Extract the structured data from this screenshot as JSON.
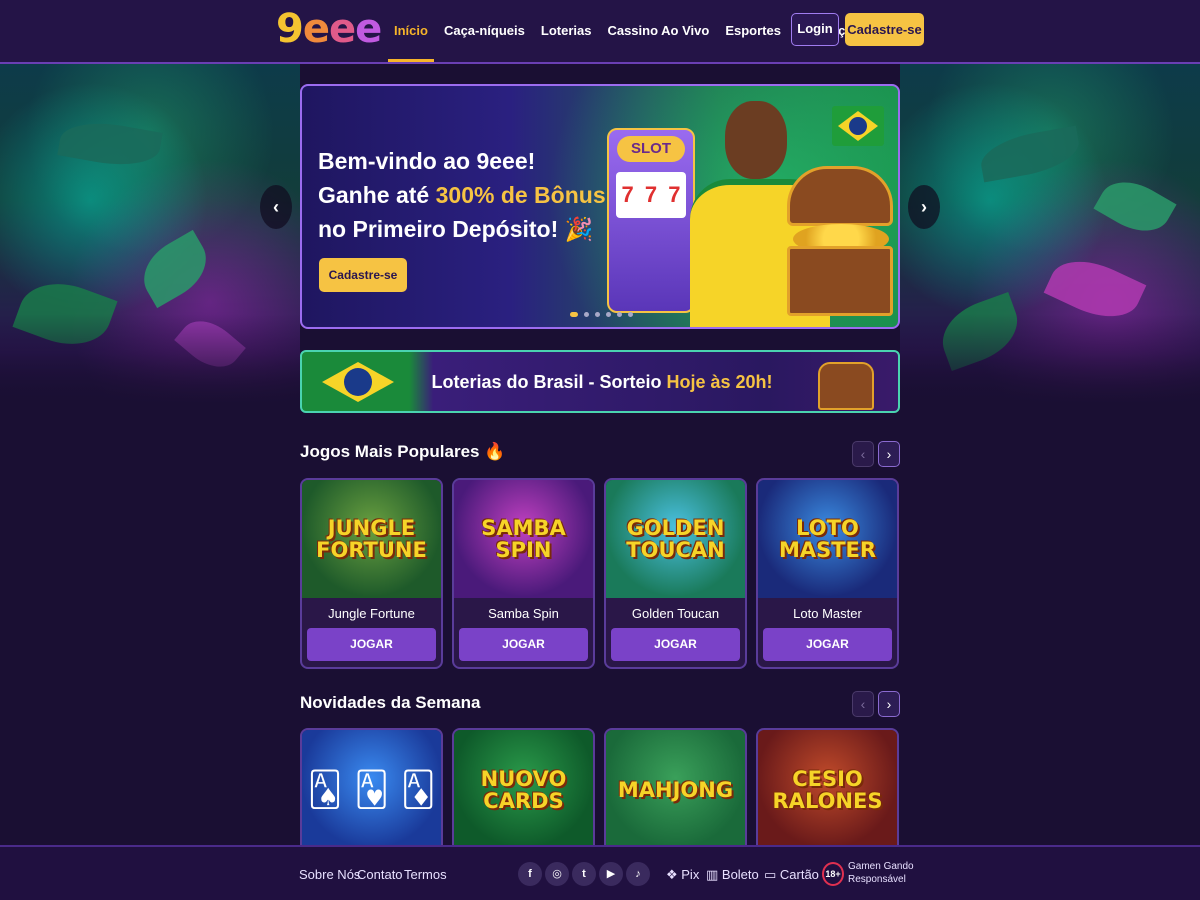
{
  "header": {
    "logo": [
      "9",
      "e",
      "e",
      "e"
    ],
    "nav": [
      "Início",
      "Caça-níqueis",
      "Loterias",
      "Cassino Ao Vivo",
      "Esportes",
      "Promoções"
    ],
    "login": "Login",
    "signup": "Cadastre-se"
  },
  "hero": {
    "line1": "Bem-vindo ao 9eee!",
    "line2_pre": "Ganhe até ",
    "line2_accent": "300% de Bônus",
    "line3": "no Primeiro Depósito! 🎉",
    "cta": "Cadastre-se",
    "slot_label": "SLOT",
    "slot_reels": [
      "7",
      "7",
      "7"
    ],
    "prev": "‹",
    "next": "›"
  },
  "lottery": {
    "text_pre": "Loterias do Brasil - Sorteio ",
    "text_accent": "Hoje às 20h!"
  },
  "popular": {
    "title": "Jogos Mais Populares 🔥",
    "prev": "‹",
    "next": "›",
    "games": [
      {
        "art": "JUNGLE FORTUNE",
        "name": "Jungle Fortune",
        "play": "JOGAR"
      },
      {
        "art": "SAMBA SPIN",
        "name": "Samba Spin",
        "play": "JOGAR"
      },
      {
        "art": "GOLDEN TOUCAN",
        "name": "Golden Toucan",
        "play": "JOGAR"
      },
      {
        "art": "LOTO MASTER",
        "name": "Loto Master",
        "play": "JOGAR"
      }
    ]
  },
  "new_week": {
    "title": "Novidades da Semana",
    "prev": "‹",
    "next": "›",
    "games": [
      {
        "art": "🂡 🂱 🃁"
      },
      {
        "art": "NUOVO CARDS"
      },
      {
        "art": "MAHJONG"
      },
      {
        "art": "CESIO RALONES"
      }
    ]
  },
  "footer": {
    "links": [
      "Sobre Nós",
      "Contato",
      "Termos"
    ],
    "social": [
      "f",
      "◎",
      "t",
      "▶",
      "♪"
    ],
    "payments": [
      "❖ Pix",
      "▥ Boleto",
      "▭ Cartão"
    ],
    "age": "18+",
    "responsible_1": "Gamen Gando",
    "responsible_2": "Responsável"
  },
  "colors": {
    "accent": "#f6c343",
    "purple": "#7a42c8",
    "background": "#1a0f33"
  }
}
